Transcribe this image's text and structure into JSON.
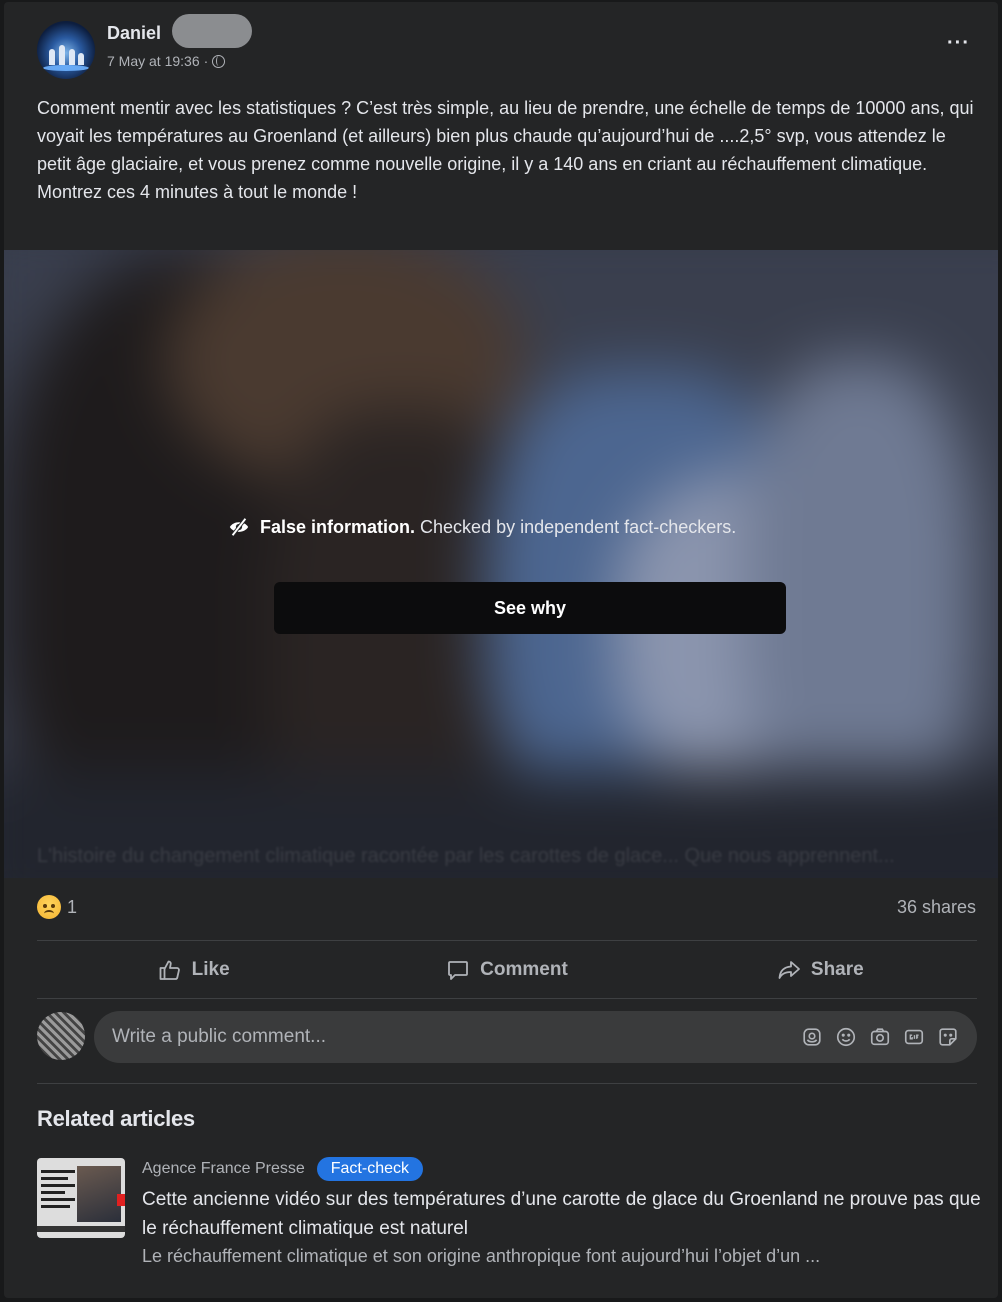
{
  "post": {
    "author": "Daniel",
    "timestamp": "7 May at 19:36",
    "separator": "·",
    "audience_icon": "globe-icon",
    "more_label": "···",
    "text": "Comment mentir avec les statistiques ? C’est très simple, au lieu de prendre, une échelle de temps de 10000 ans, qui voyait les températures au Groenland (et ailleurs) bien plus chaude qu’aujourd’hui de ....2,5° svp, vous attendez le petit âge glaciaire, et vous prenez comme nouvelle origine, il y a 140 ans en criant au réchauffement climatique. Montrez ces 4 minutes à tout le monde !"
  },
  "media": {
    "warning_title": "False information.",
    "warning_text": " Checked by independent fact-checkers.",
    "see_why_label": "See why",
    "blurred_caption": "L'histoire du changement climatique racontée par les carottes de glace... Que nous apprennent..."
  },
  "stats": {
    "reaction_icon": "sad-emoji-icon",
    "reaction_count": "1",
    "shares": "36 shares"
  },
  "actions": {
    "like": "Like",
    "comment": "Comment",
    "share": "Share"
  },
  "comment_input": {
    "placeholder": "Write a public comment..."
  },
  "related": {
    "title": "Related articles",
    "items": [
      {
        "source": "Agence France Presse",
        "badge": "Fact-check",
        "headline": "Cette ancienne vidéo sur des températures d’une carotte de glace du Groenland ne prouve pas que le réchauffement climatique est naturel",
        "summary": "Le réchauffement climatique et son origine anthropique font aujourd’hui l’objet d’un ..."
      }
    ]
  },
  "colors": {
    "background": "#18191a",
    "card": "#242526",
    "text_primary": "#e4e6eb",
    "text_secondary": "#b0b3b8",
    "badge_blue": "#2374e1",
    "button_dark": "#0c0c0d"
  }
}
